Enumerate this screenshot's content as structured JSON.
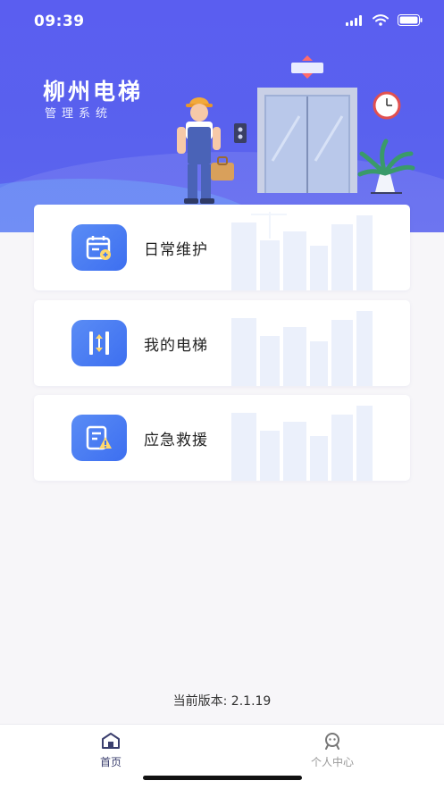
{
  "status_bar": {
    "time": "09:39"
  },
  "header": {
    "title": "柳州电梯",
    "subtitle": "管理系统"
  },
  "menu": [
    {
      "label": "日常维护",
      "icon": "calendar-wrench-icon"
    },
    {
      "label": "我的电梯",
      "icon": "elevator-icon"
    },
    {
      "label": "应急救援",
      "icon": "warning-document-icon"
    }
  ],
  "footer": {
    "version": "当前版本: 2.1.19"
  },
  "tabbar": {
    "home_label": "首页",
    "profile_label": "个人中心"
  },
  "colors": {
    "primary": "#5a5ef0",
    "icon_blue": "#4a7ef2",
    "active_tab": "#3b3f6e",
    "inactive_tab": "#999999"
  }
}
